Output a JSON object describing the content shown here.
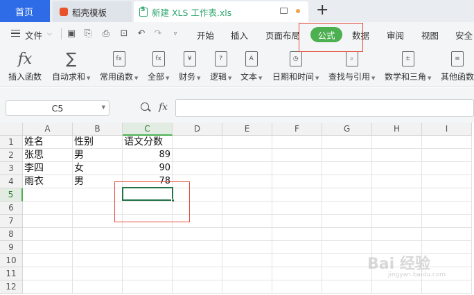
{
  "tabs": {
    "home": "首页",
    "template": "稻壳模板",
    "file": "新建 XLS 工作表.xls",
    "new_tab": "+"
  },
  "menu": {
    "file": "文件",
    "items": [
      "开始",
      "插入",
      "页面布局",
      "公式",
      "数据",
      "审阅",
      "视图",
      "安全"
    ],
    "active": "公式"
  },
  "ribbon": [
    {
      "label": "插入函数",
      "icon": "fx-icon",
      "glyph": "fx",
      "caret": false
    },
    {
      "label": "自动求和",
      "icon": "sigma-icon",
      "glyph": "∑",
      "caret": true
    },
    {
      "label": "常用函数",
      "icon": "star-fx-icon",
      "glyph": "fx",
      "caret": true
    },
    {
      "label": "全部",
      "icon": "all-fx-icon",
      "glyph": "fx",
      "caret": true
    },
    {
      "label": "财务",
      "icon": "yen-icon",
      "glyph": "¥",
      "caret": true
    },
    {
      "label": "逻辑",
      "icon": "question-icon",
      "glyph": "?",
      "caret": true
    },
    {
      "label": "文本",
      "icon": "text-a-icon",
      "glyph": "A",
      "caret": true
    },
    {
      "label": "日期和时间",
      "icon": "clock-icon",
      "glyph": "◷",
      "caret": true
    },
    {
      "label": "查找与引用",
      "icon": "search-doc-icon",
      "glyph": "⌕",
      "caret": true
    },
    {
      "label": "数学和三角",
      "icon": "math-icon",
      "glyph": "±",
      "caret": true
    },
    {
      "label": "其他函数",
      "icon": "more-fx-icon",
      "glyph": "≡",
      "caret": false
    }
  ],
  "formula_bar": {
    "name_box": "C5",
    "fx": "fx",
    "formula": ""
  },
  "sheet": {
    "columns": [
      "A",
      "B",
      "C",
      "D",
      "E",
      "F",
      "G",
      "H",
      "I"
    ],
    "rows": [
      "1",
      "2",
      "3",
      "4",
      "5",
      "6",
      "7",
      "8",
      "9",
      "10",
      "11",
      "12"
    ],
    "selected_col": "C",
    "selected_row": "5",
    "cells": [
      {
        "ref": "A1",
        "value": "姓名"
      },
      {
        "ref": "B1",
        "value": "性别"
      },
      {
        "ref": "C1",
        "value": "语文分数"
      },
      {
        "ref": "A2",
        "value": "张思"
      },
      {
        "ref": "B2",
        "value": "男"
      },
      {
        "ref": "C2",
        "value": "89"
      },
      {
        "ref": "A3",
        "value": "李四"
      },
      {
        "ref": "B3",
        "value": "女"
      },
      {
        "ref": "C3",
        "value": "90"
      },
      {
        "ref": "A4",
        "value": "雨衣"
      },
      {
        "ref": "B4",
        "value": "男"
      },
      {
        "ref": "C4",
        "value": "78"
      }
    ]
  },
  "watermark": {
    "main": "Bai 经验",
    "sub": "jingyan.baidu.com"
  },
  "colors": {
    "home_tab": "#2e6be6",
    "active_menu": "#4caf50",
    "selection": "#217346",
    "annotation": "#e74c3c"
  }
}
